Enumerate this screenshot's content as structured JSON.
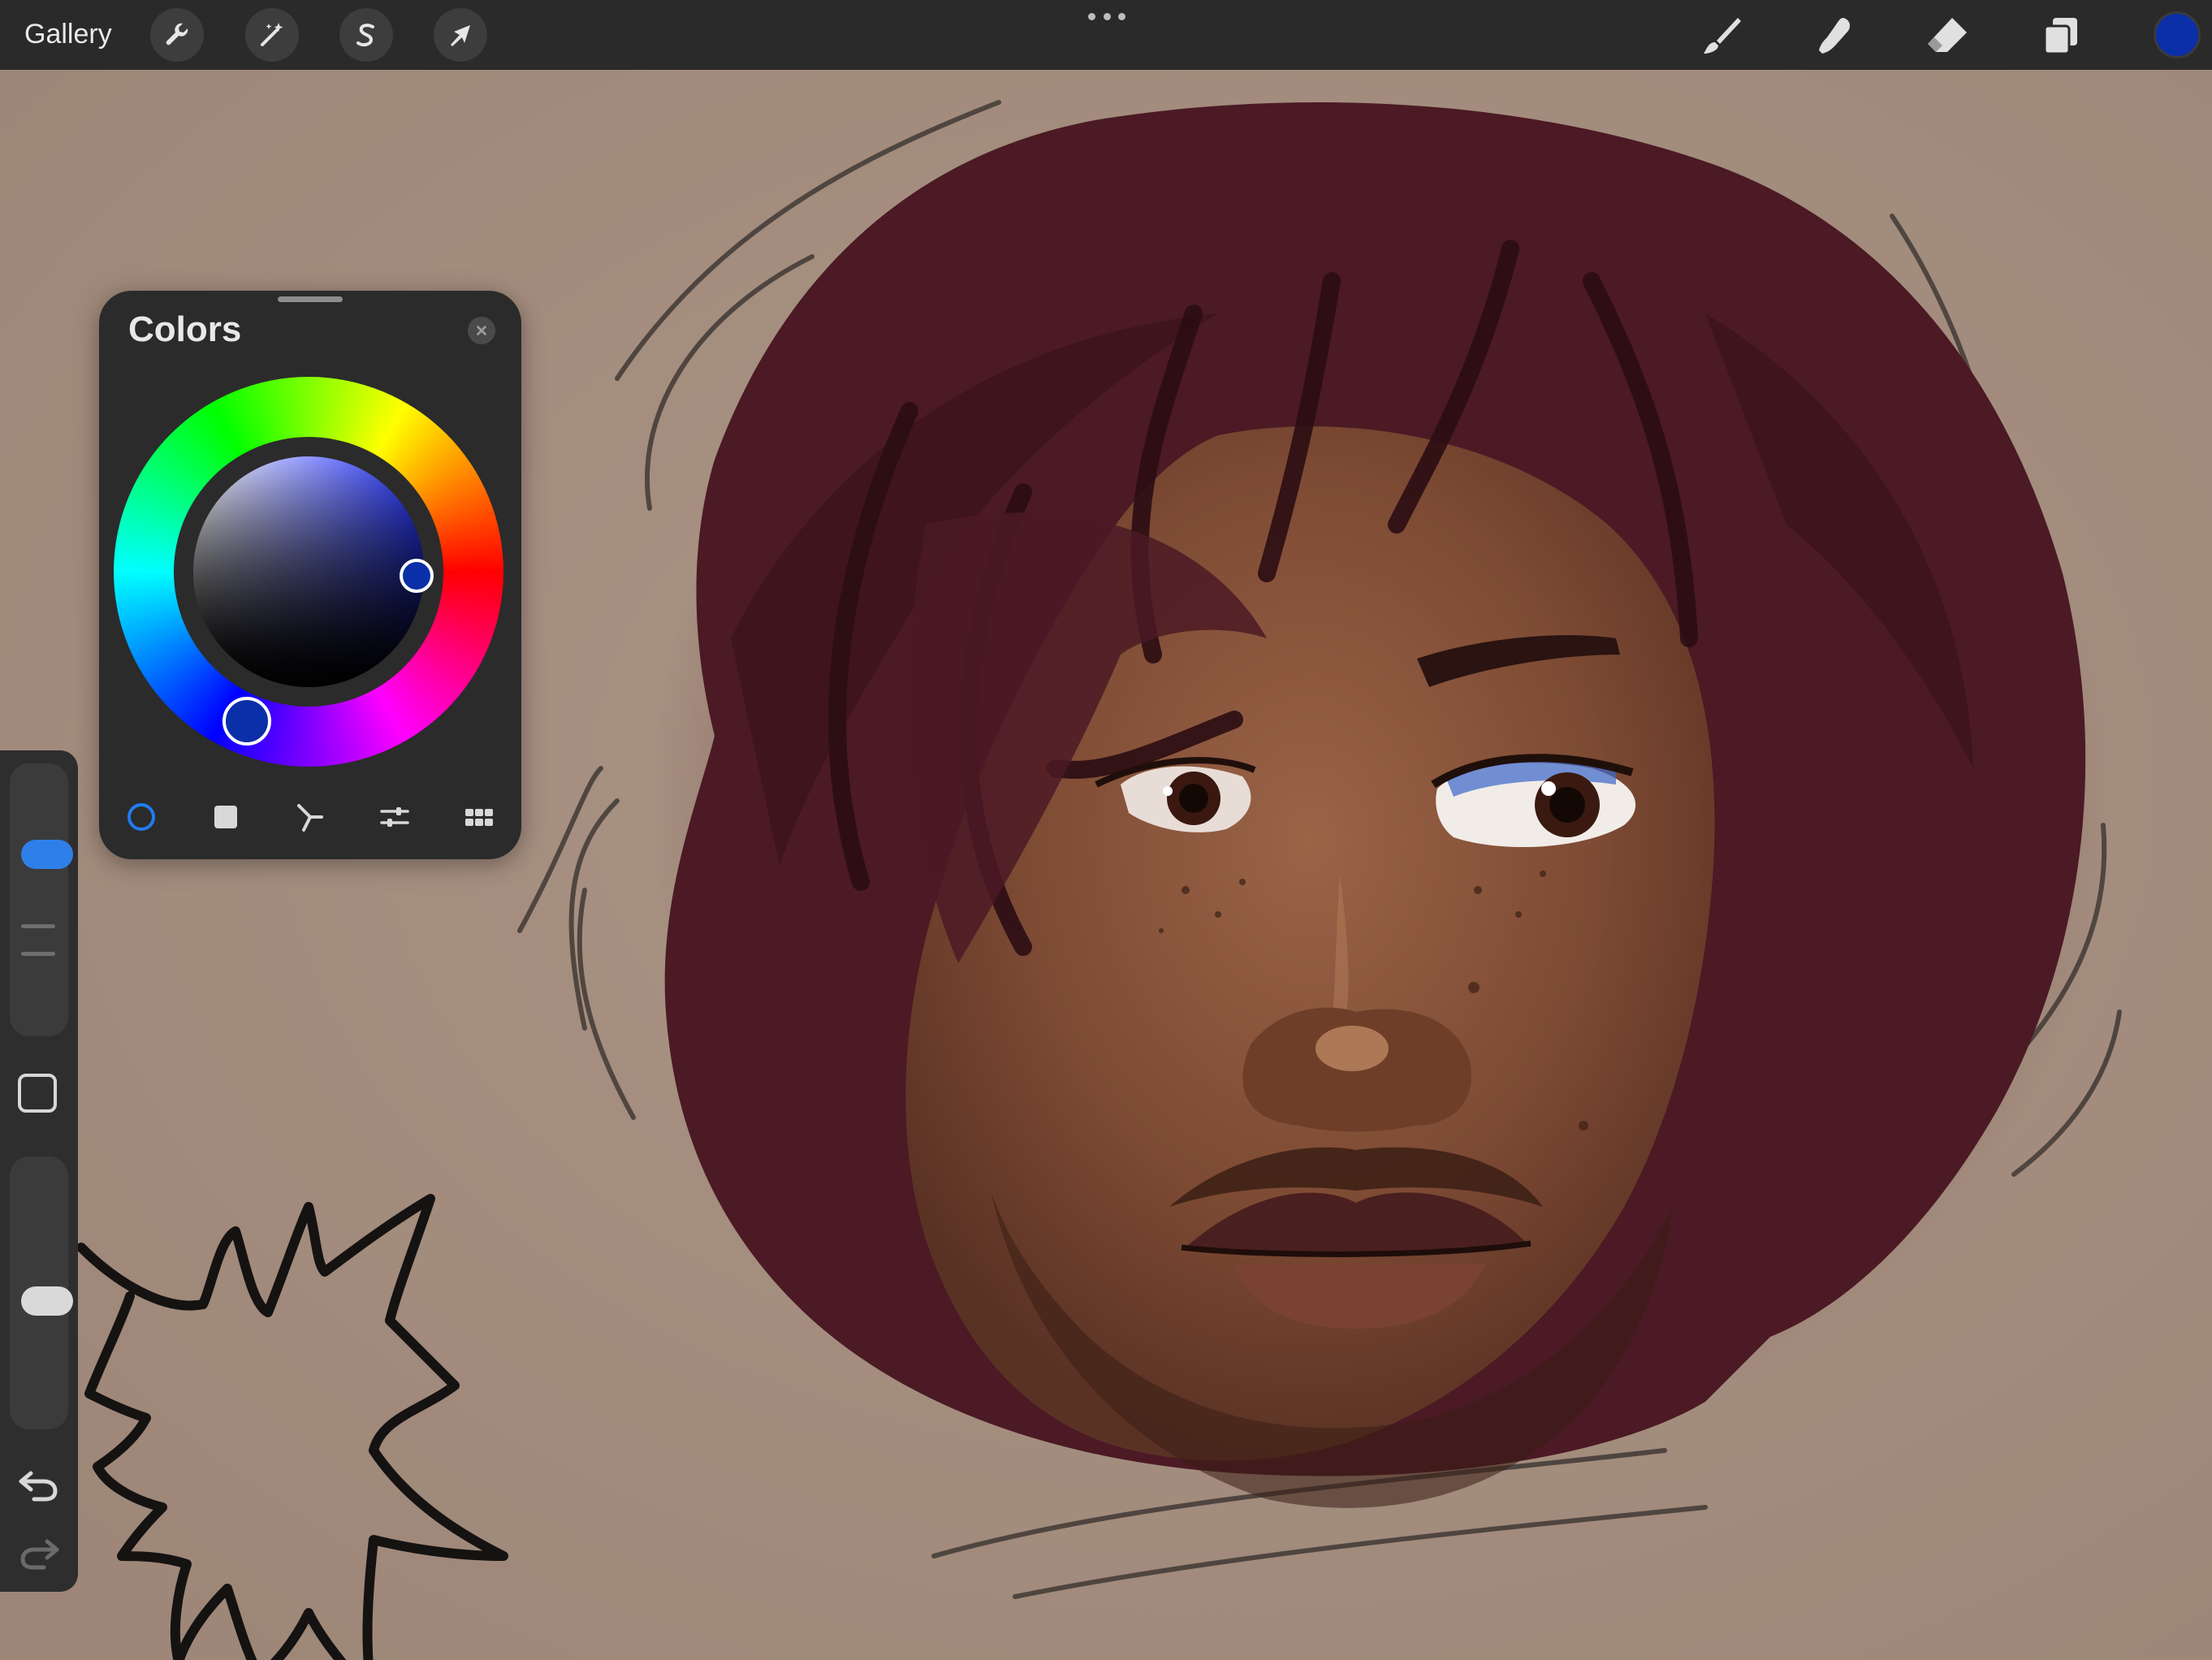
{
  "app": {
    "gallery_label": "Gallery"
  },
  "toolbar_left": [
    {
      "name": "actions",
      "icon": "wrench-icon"
    },
    {
      "name": "adjustments",
      "icon": "magic-wand-icon"
    },
    {
      "name": "selection",
      "icon": "selection-s-icon"
    },
    {
      "name": "transform",
      "icon": "arrow-cursor-icon"
    }
  ],
  "toolbar_right": [
    {
      "name": "brush",
      "icon": "brush-icon"
    },
    {
      "name": "smudge",
      "icon": "smudge-finger-icon"
    },
    {
      "name": "eraser",
      "icon": "eraser-icon"
    },
    {
      "name": "layers",
      "icon": "layers-icon"
    }
  ],
  "current_color": "#0b2fa8",
  "colors_panel": {
    "title": "Colors",
    "active_tab": "disc",
    "tabs": [
      {
        "name": "disc",
        "icon": "color-disc-icon"
      },
      {
        "name": "classic",
        "icon": "classic-square-icon"
      },
      {
        "name": "harmony",
        "icon": "harmony-icon"
      },
      {
        "name": "value",
        "icon": "sliders-icon"
      },
      {
        "name": "palettes",
        "icon": "palette-grid-icon"
      }
    ],
    "accent_color": "#1f7cf0"
  },
  "sidebar": {
    "brush_size_knob_color": "#2f7fe8",
    "opacity_knob_color": "#d9d9d9"
  },
  "canvas": {
    "paper_color": "#a48d7e"
  }
}
